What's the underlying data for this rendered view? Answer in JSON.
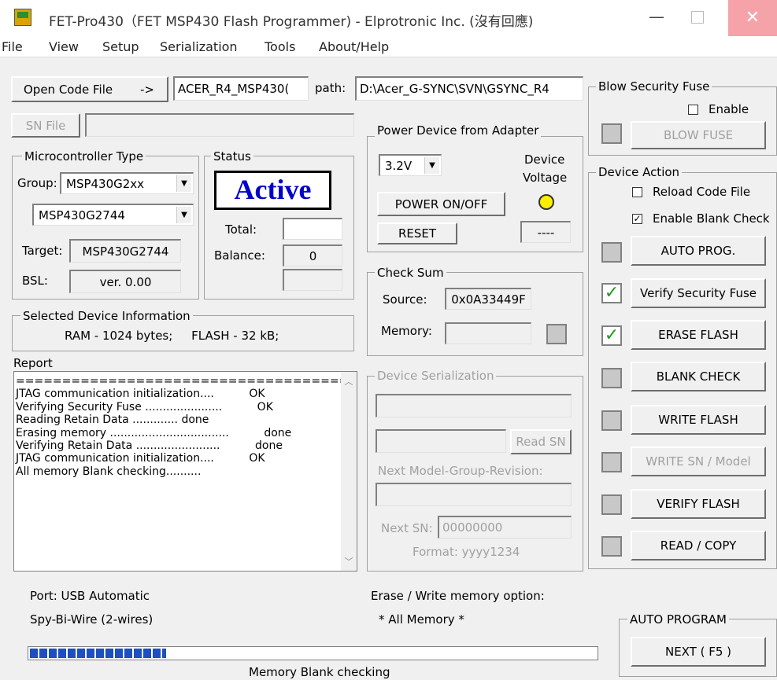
{
  "window": {
    "title": "FET-Pro430（FET MSP430 Flash Programmer) - Elprotronic Inc. (沒有回應)",
    "min_glyph": "—",
    "close_glyph": "✕"
  },
  "menu": [
    "File",
    "View",
    "Setup",
    "Serialization",
    "Tools",
    "About/Help"
  ],
  "code_file": {
    "button": "Open Code File",
    "arrow": "->",
    "file_name": "ACER_R4_MSP430(",
    "path_label": "path:",
    "path_value": "D:\\Acer_G-SYNC\\SVN\\GSYNC_R4"
  },
  "sn_file": {
    "button": "SN File",
    "value": ""
  },
  "microcontroller": {
    "title": "Microcontroller Type",
    "group_label": "Group:",
    "group_value": "MSP430G2xx",
    "device_value": "MSP430G2744",
    "target_label": "Target:",
    "target_value": "MSP430G2744",
    "bsl_label": "BSL:",
    "bsl_value": "ver.  0.00"
  },
  "status": {
    "title": "Status",
    "state": "Active",
    "total_label": "Total:",
    "total_value": "",
    "balance_label": "Balance:",
    "balance_value": "0",
    "extra_value": ""
  },
  "selected_device": {
    "title": "Selected Device Information",
    "info": "RAM - 1024 bytes;     FLASH - 32 kB;"
  },
  "power": {
    "title": "Power Device from Adapter",
    "voltage": "3.2V",
    "device_voltage_label_1": "Device",
    "device_voltage_label_2": "Voltage",
    "power_button": "POWER ON/OFF",
    "reset_button": "RESET",
    "voltage_readout": "----"
  },
  "checksum": {
    "title": "Check Sum",
    "source_label": "Source:",
    "source_value": "0x0A33449F",
    "memory_label": "Memory:",
    "memory_value": ""
  },
  "serialization": {
    "title": "Device Serialization",
    "read_sn_button": "Read SN",
    "next_model_label": "Next Model-Group-Revision:",
    "next_sn_label": "Next SN:",
    "next_sn_value": "00000000",
    "format_label": "Format: yyyy1234"
  },
  "blow_fuse": {
    "title": "Blow Security Fuse",
    "enable_label": "Enable",
    "button": "BLOW FUSE"
  },
  "device_action": {
    "title": "Device Action",
    "reload_label": "Reload Code File",
    "blank_check_label": "Enable Blank Check",
    "buttons": [
      "AUTO PROG.",
      "Verify Security Fuse",
      "ERASE FLASH",
      "BLANK CHECK",
      "WRITE FLASH",
      "WRITE SN / Model",
      "VERIFY FLASH",
      "READ / COPY"
    ],
    "checkmark": "✓"
  },
  "report": {
    "title": "Report",
    "lines": [
      "=====================================",
      "JTAG communication initialization....          OK",
      "Verifying Security Fuse ......................          OK",
      "Reading Retain Data ............. done",
      "Erasing memory ..................................          done",
      "Verifying Retain Data ........................          done",
      "JTAG communication initialization....          OK",
      "All memory Blank checking.........."
    ]
  },
  "footer": {
    "port": "Port: USB Automatic",
    "wire": "Spy-Bi-Wire (2-wires)",
    "erase_option_label": "Erase / Write memory option:",
    "erase_option_value": "* All Memory *",
    "auto_program_title": "AUTO PROGRAM",
    "next_button": "NEXT  ( F5 )",
    "progress_fraction": 0.24,
    "progress_text": "Memory Blank checking"
  }
}
